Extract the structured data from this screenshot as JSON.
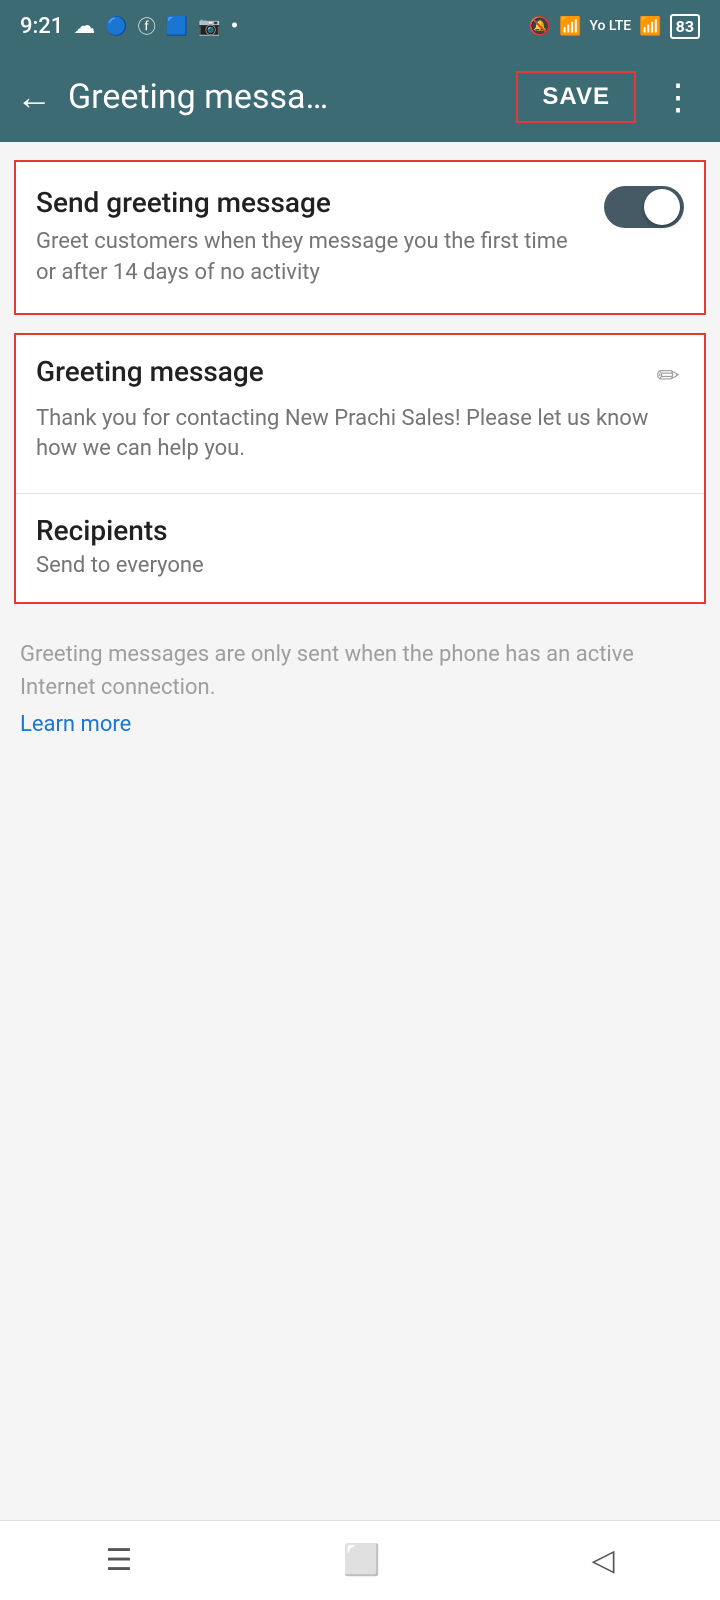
{
  "statusBar": {
    "time": "9:21",
    "battery": "83"
  },
  "appBar": {
    "title": "Greeting messa…",
    "backLabel": "←",
    "saveLabel": "SAVE",
    "moreLabel": "⋮"
  },
  "sendGreetingCard": {
    "title": "Send greeting message",
    "description": "Greet customers when they message you the first time or after 14 days of no activity",
    "toggleEnabled": true
  },
  "greetingMessageCard": {
    "title": "Greeting message",
    "messageText": "Thank you for contacting New Prachi Sales! Please let us know how we can help you.",
    "recipientsTitle": "Recipients",
    "recipientsDesc": "Send to everyone"
  },
  "footerNote": {
    "text": "Greeting messages are only sent when the phone has an active Internet connection.",
    "learnMoreLabel": "Learn more"
  },
  "colors": {
    "appBarBg": "#3d6b74",
    "toggleBg": "#455a64",
    "borderHighlight": "#e53935",
    "linkColor": "#1976d2"
  }
}
